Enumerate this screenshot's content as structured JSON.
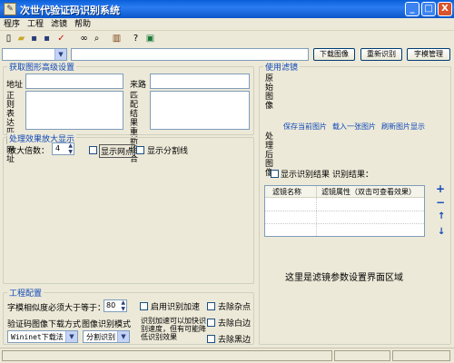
{
  "window": {
    "title": "次世代验证码识别系统",
    "minimize": "_",
    "maximize": "□",
    "close": "X"
  },
  "menu": [
    "程序",
    "工程",
    "滤镜",
    "帮助"
  ],
  "toolbar_icons": [
    "new-icon",
    "open-icon",
    "save-icon",
    "save-as-icon",
    "check-icon",
    "binoculars-icon",
    "find-icon",
    "books-icon",
    "help-icon",
    "image-icon"
  ],
  "top": {
    "combo_value": "",
    "url_value": "",
    "download_label": "下载图像",
    "reidentify_label": "重新识别",
    "font_manage_label": "字模管理"
  },
  "get_settings": {
    "title": "获取图形高级设置",
    "address_label": "地址",
    "source_label": "来路",
    "regex_label": "正则表达匹配网址",
    "match_label": "匹配结果重新组合"
  },
  "zoom_section": {
    "title": "处理效果放大显示",
    "zoom_label": "放大倍数：",
    "zoom_value": "4",
    "show_pixels_label": "显示网点",
    "show_split_label": "显示分割线"
  },
  "project": {
    "title": "工程配置",
    "similarity_label": "字模相似度必须大于等于：",
    "similarity_value": "80",
    "download_mode_label": "验证码图像下载方式",
    "recognize_mode_label": "图像识别模式",
    "download_mode_value": "Wininet下载法",
    "recognize_mode_value": "分割识别",
    "accelerate_label": "启用识别加速",
    "accelerate_note": "识别加速可以加快识别速度，但有可能降低识别效果",
    "remove_noise_label": "去除杂点",
    "remove_white_label": "去除白边",
    "remove_black_label": "去除黑边"
  },
  "filter": {
    "title": "使用滤镜",
    "original_label": "原始图像",
    "processed_label": "处理后图像",
    "save_current": "保存当前图片",
    "load_one": "载入一张图片",
    "refresh": "刷新图片显示",
    "show_result_label": "显示识别结果",
    "result_label": "识别结果：",
    "col_name": "滤镜名称",
    "col_attr": "滤镜属性（双击可查看效果）",
    "add": "+",
    "remove": "−",
    "up": "↑",
    "down": "↓",
    "params_area": "这里是滤镜参数设置界面区域"
  }
}
